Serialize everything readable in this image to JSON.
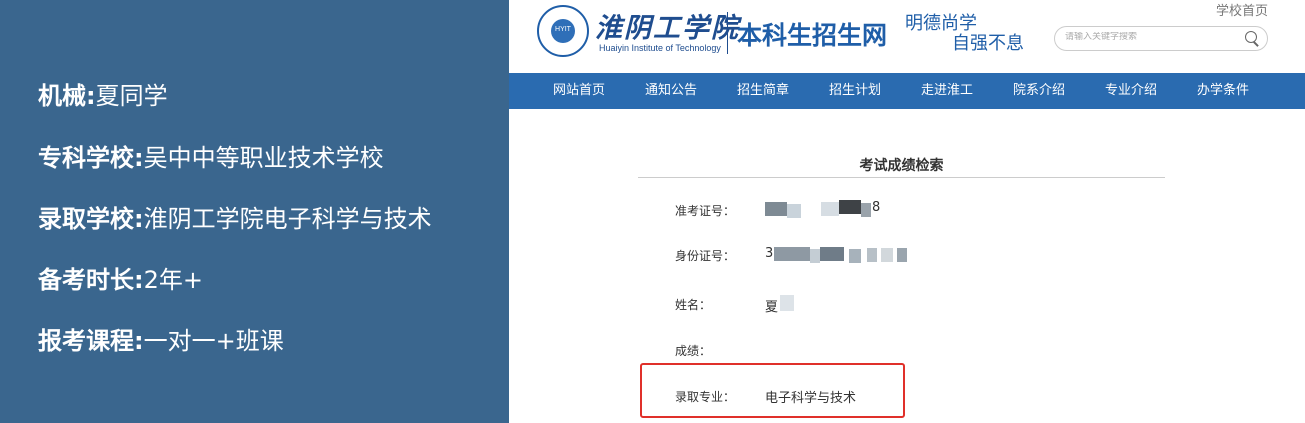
{
  "overlay": {
    "rows": [
      {
        "label": "机械:",
        "value": "夏同学"
      },
      {
        "label": "专科学校:",
        "value": "吴中中等职业技术学校"
      },
      {
        "label": "录取学校:",
        "value": "淮阴工学院电子科学与技术"
      },
      {
        "label": "备考时长:",
        "value": "2年+"
      },
      {
        "label": "报考课程:",
        "value": "一对一+班课"
      }
    ]
  },
  "header": {
    "logo_cn": "淮阴工学院",
    "logo_en": "Huaiyin Institute of Technology",
    "logo_badge": "HYIT",
    "site_title": "本科生招生网",
    "motto_line1": "明德尚学",
    "motto_line2": "自强不息",
    "top_link": "学校首页"
  },
  "search": {
    "placeholder": "请输入关键字搜索"
  },
  "nav": {
    "items": [
      "网站首页",
      "通知公告",
      "招生简章",
      "招生计划",
      "走进淮工",
      "院系介绍",
      "专业介绍",
      "办学条件"
    ]
  },
  "panel": {
    "title": "考试成绩检索",
    "fields": [
      {
        "label": "准考证号：",
        "value": "8"
      },
      {
        "label": "身份证号：",
        "value": "3"
      },
      {
        "label": "姓名：",
        "value": "夏"
      },
      {
        "label": "成绩：",
        "value": ""
      },
      {
        "label": "录取专业：",
        "value": "电子科学与技术"
      }
    ]
  },
  "colors": {
    "overlay_bg": "#3a668e",
    "nav_bg": "#2a6bb0",
    "brand_blue": "#1f5ea8",
    "highlight_red": "#e0302a"
  }
}
